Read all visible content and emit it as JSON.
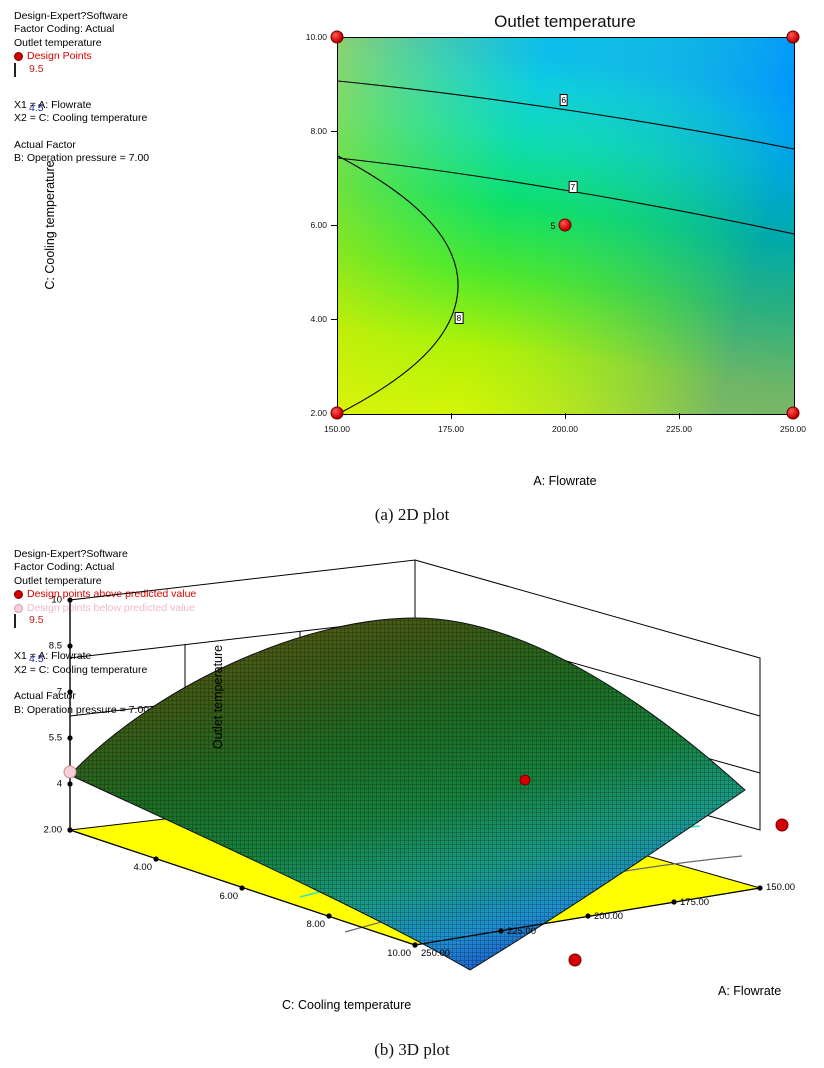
{
  "figure": {
    "caption_a": "(a)  2D plot",
    "caption_b": "(b)  3D plot"
  },
  "legend2d": {
    "software": "Design-Expert?Software",
    "factor_coding": "Factor Coding: Actual",
    "response": "Outlet temperature",
    "design_points": "Design Points",
    "scale_high": "9.5",
    "scale_low": "4.5",
    "x1": "X1 = A: Flowrate",
    "x2": "X2 = C: Cooling temperature",
    "actual_factor_header": "Actual Factor",
    "actual_factor_value": "B: Operation pressure = 7.00"
  },
  "legend3d": {
    "software": "Design-Expert?Software",
    "factor_coding": "Factor Coding: Actual",
    "response": "Outlet temperature",
    "points_above": "Design points above predicted value",
    "points_below": "Design points below predicted value",
    "scale_high": "9.5",
    "scale_low": "4.5",
    "x1": "X1 = A: Flowrate",
    "x2": "X2 = C: Cooling temperature",
    "actual_factor_header": "Actual Factor",
    "actual_factor_value": "B: Operation pressure = 7.00"
  },
  "chart_data": [
    {
      "type": "heatmap",
      "title": "Outlet temperature",
      "xlabel": "A: Flowrate",
      "ylabel": "C: Cooling temperature",
      "xlim": [
        150,
        250
      ],
      "ylim": [
        2,
        10
      ],
      "xticks": [
        "150.00",
        "175.00",
        "200.00",
        "225.00",
        "250.00"
      ],
      "xtick_values": [
        150,
        175,
        200,
        225,
        250
      ],
      "yticks": [
        "2.00",
        "4.00",
        "6.00",
        "8.00",
        "10.00"
      ],
      "ytick_values": [
        2,
        4,
        6,
        8,
        10
      ],
      "zlabel": "Outlet temperature",
      "zlim": [
        4.5,
        9.5
      ],
      "colorbar": {
        "high": "9.5",
        "low": "4.5",
        "high_color": "#ff0000",
        "mid_color": "#00c000",
        "low_color": "#0000cc"
      },
      "contours": [
        {
          "label": "6",
          "label_x": 200,
          "label_y": 9.35
        },
        {
          "label": "7",
          "label_x": 200,
          "label_y": 7.75
        },
        {
          "label": "8",
          "label_x": 177,
          "label_y": 3.95
        }
      ],
      "design_points": [
        {
          "x": 150,
          "y": 2
        },
        {
          "x": 150,
          "y": 10
        },
        {
          "x": 250,
          "y": 2
        },
        {
          "x": 250,
          "y": 10
        },
        {
          "x": 200,
          "y": 6,
          "label": "5"
        }
      ],
      "grid": false,
      "legend": "left"
    },
    {
      "type": "surface",
      "title": "Outlet temperature",
      "xlabel": "A: Flowrate",
      "ylabel": "C: Cooling temperature",
      "zlabel": "Outlet temperature",
      "xticks": [
        "150.00",
        "175.00",
        "200.00",
        "225.00",
        "250.00"
      ],
      "yticks": [
        "2.00",
        "4.00",
        "6.00",
        "8.00",
        "10.00"
      ],
      "zticks": [
        "2.00",
        "4",
        "5.5",
        "7",
        "8.5",
        "10"
      ],
      "ztick_values": [
        2,
        4,
        5.5,
        7,
        8.5,
        10
      ],
      "zlim": [
        2,
        10
      ],
      "floor_color": "#ffff00",
      "surface_colors": [
        "#4a4a10",
        "#2f5f14",
        "#1e8c3c",
        "#2fc0a0",
        "#2aa8e0",
        "#1f6fd0"
      ],
      "design_points": [
        {
          "kind": "above",
          "label": "center"
        },
        {
          "kind": "above",
          "label": "right-edge"
        },
        {
          "kind": "above",
          "label": "front-low"
        },
        {
          "kind": "below",
          "label": "left-edge"
        }
      ],
      "grid": true,
      "legend": "left"
    }
  ]
}
